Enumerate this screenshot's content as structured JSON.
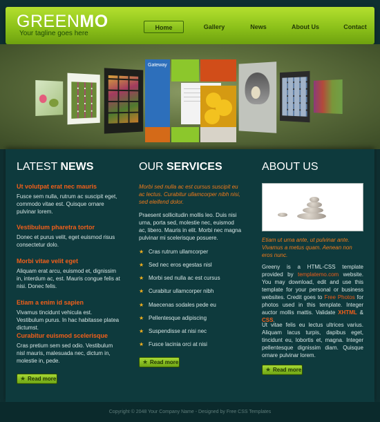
{
  "logo": {
    "green": "GREEN",
    "mo": "MO",
    "tagline": "Your tagline goes here"
  },
  "nav": {
    "home": "Home",
    "gallery": "Gallery",
    "news": "News",
    "about": "About Us",
    "contact": "Contact"
  },
  "hero": {
    "gateway_label": "Gateway"
  },
  "news": {
    "heading_light": "LATEST ",
    "heading_bold": "NEWS",
    "items": [
      {
        "title": "Ut volutpat erat nec mauris",
        "body": "Fusce sem nulla, rutrum ac suscipit eget, commodo vitae est. Quisque ornare pulvinar lorem."
      },
      {
        "title": "Vestibulum pharetra tortor",
        "body": "Donec et purus velit, eget euismod risus consectetur dolo."
      },
      {
        "title": "Morbi vitae velit eget",
        "body": "Aliquam erat arcu, euismod et, dignissim in, interdum ac, est. Mauris congue felis at nisi. Donec felis."
      },
      {
        "title": "Etiam a enim id sapien",
        "body": "Vivamus tincidunt vehicula est. Vestibulum purus. In hac habitasse platea dictumst."
      },
      {
        "title": "Curabitur euismod scelerisque",
        "body": "Cras pretium sem sed odio. Vestibulum nisl mauris, malesuada nec, dictum in, molestie in, pede."
      }
    ],
    "read_more": "Read more"
  },
  "services": {
    "heading_light": "OUR ",
    "heading_bold": "SERVICES",
    "intro": "Morbi sed nulla ac est cursus suscipit eu ac lectus. Curabitur ullamcorper nibh nisi, sed eleifend dolor.",
    "paragraph": "Praesent sollicitudin mollis leo. Duis nisi urna, porta sed, molestie nec, euismod ac, libero. Mauris in elit. Morbi nec magna pulvinar mi scelerisque posuere.",
    "list": [
      "Cras rutrum ullamcorper",
      "Sed nec eros egestas nisl",
      "Morbi sed nulla ac est cursus",
      "Curabitur ullamcorper nibh",
      "Maecenas sodales pede eu",
      "Pellentesque adipiscing",
      "Suspendisse at nisi nec",
      "Fusce lacinia orci at nisi"
    ],
    "read_more": "Read more"
  },
  "about": {
    "heading": "ABOUT US",
    "intro": "Etiam ut urna ante, ut pulvinar ante. Vivamus a metus quam. Aenean non eros nunc.",
    "p1_a": "Greeny is a HTML-CSS template provided by ",
    "p1_link": "templatemo.com",
    "p1_b": " website. You may download, edit and use this template for your personal or business websites. Credit goes to ",
    "p1_link2": "Free Photos",
    "p1_c": " for photos used in this template. Integer auctor mollis mattis. Validate ",
    "p1_xhtml": "XHTML",
    "p1_and": " & ",
    "p1_css": "CSS",
    "p1_end": ".",
    "p2": "Ut vitae felis eu lectus ultrices varius. Aliquam lacus turpis, dapibus eget, tincidunt eu, lobortis et, magna. Integer pellentesque dignissim diam. Quisque ornare pulvinar lorem.",
    "read_more": "Read more"
  },
  "footer": {
    "text": "Copyright © 2048 Your Company Name - Designed by Free CSS Templates"
  },
  "colors": {
    "accent_green": "#8cc11a",
    "accent_orange": "#f25f1a",
    "content_bg": "#0e3a3d"
  }
}
